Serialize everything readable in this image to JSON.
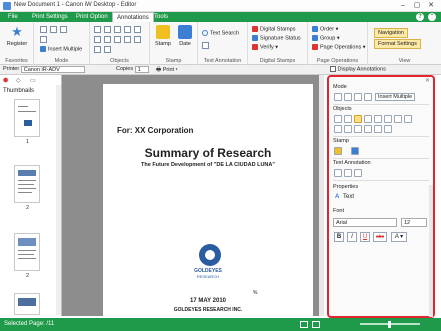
{
  "window": {
    "title": "New Document 1 - Canon iW Desktop - Editor"
  },
  "tabs": [
    {
      "label": "File"
    },
    {
      "label": "Print Settings"
    },
    {
      "label": "Print Option"
    },
    {
      "label": "Annotations"
    },
    {
      "label": "Tools"
    }
  ],
  "ribbon": {
    "favorites": {
      "register_label": "Register",
      "group_label": "Favorites"
    },
    "mode": {
      "insert_multiple": "Insert Multiple",
      "group_label": "Mode"
    },
    "objects": {
      "group_label": "Objects"
    },
    "stamp": {
      "stamp_label": "Stamp",
      "date_label": "Date",
      "group_label": "Stamp"
    },
    "text_annotation": {
      "text_search": "Text Search",
      "group_label": "Text Annotation"
    },
    "digital_stamps": {
      "digital_stamps": "Digital Stamps",
      "signature_status": "Signature Status",
      "verify": "Verify",
      "group_label": "Digital Stamps"
    },
    "page_operations": {
      "order": "Order",
      "group": "Group",
      "page_operations": "Page Operations",
      "group_label": "Page Operations"
    },
    "view": {
      "navigation": "Navigation",
      "format_settings": "Format Settings",
      "group_label": "View"
    }
  },
  "toolbar": {
    "printer_label": "Printer",
    "printer_value": "Canon iR-ADV",
    "copies_label": "Copies",
    "copies_value": "1",
    "print_label": "Print",
    "display_annotations": "Display Annotations"
  },
  "thumbnails": {
    "title": "Thumbnails",
    "pages": [
      "1",
      "2",
      "2"
    ]
  },
  "document": {
    "for_line": "For: XX Corporation",
    "heading": "Summary of Research",
    "subheading": "The Future Development of \"DE LA CIUDAD LUNA\"",
    "logo_text": "GOLDEYES",
    "logo_sub": "RESEARCH",
    "page_marker": "%",
    "date": "17 MAY 2010",
    "company": "GOLDEYES RESEARCH INC."
  },
  "format_panel": {
    "mode_label": "Mode",
    "insert_multiple": "Insert Multiple",
    "objects_label": "Objects",
    "stamp_label": "Stamp",
    "text_annotation_label": "Text Annotation",
    "properties_label": "Properties",
    "text_label": "Text",
    "font_label": "Font",
    "font_name": "Arial",
    "font_size": "12",
    "bold": "B",
    "italic": "I",
    "underline": "U",
    "strike": "abc",
    "color_a": "A",
    "text_icon": "A"
  },
  "status": {
    "selected_page": "Selected Page: /11"
  },
  "colors": {
    "accent": "#1f9a4a",
    "highlight": "#e4242c"
  }
}
